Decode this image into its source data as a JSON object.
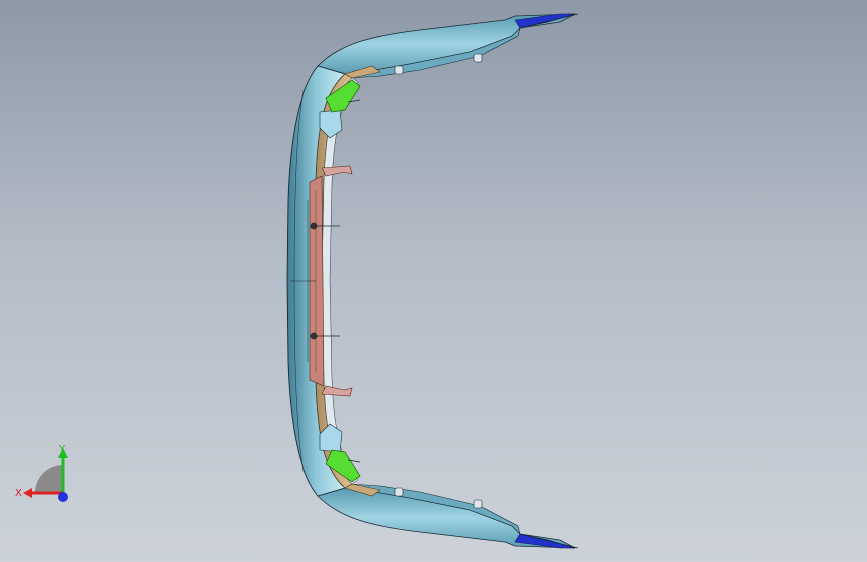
{
  "viewport": {
    "background_top": "#8e99a8",
    "background_bottom": "#cdd2d9"
  },
  "model": {
    "icon": "bumper-part-model",
    "colors": {
      "outer_skin": "#8ec7d8",
      "outer_skin_dark": "#4d8aa0",
      "inner_flange": "#c8a878",
      "bracket_green": "#55dd33",
      "center_panel": "#c88478",
      "end_tip_blue": "#2233cc",
      "edge_line": "#1a2a33"
    }
  },
  "triad": {
    "x_label": "X",
    "y_label": "Y",
    "x_color": "#dd2222",
    "y_color": "#22bb22",
    "z_color": "#2233dd",
    "plane_color": "#8a8a8a"
  }
}
